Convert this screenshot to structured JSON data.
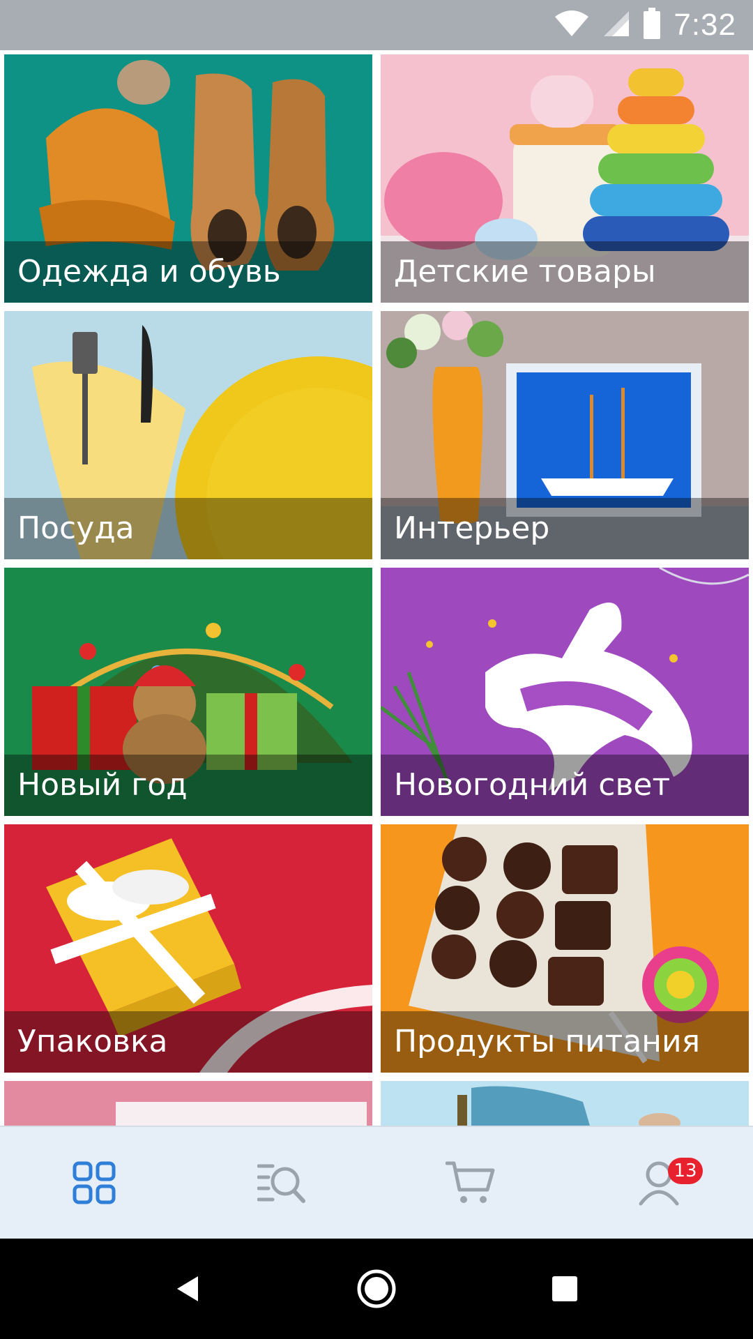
{
  "status_bar": {
    "time": "7:32",
    "icons": [
      "wifi-icon",
      "cell-signal-icon",
      "battery-icon"
    ]
  },
  "categories": [
    {
      "label": "Одежда и обувь",
      "image": "clothes-and-shoes-image"
    },
    {
      "label": "Детские товары",
      "image": "kids-goods-image"
    },
    {
      "label": "Посуда",
      "image": "tableware-image"
    },
    {
      "label": "Интерьер",
      "image": "interior-image"
    },
    {
      "label": "Новый год",
      "image": "new-year-image"
    },
    {
      "label": "Новогодний свет",
      "image": "new-year-lights-image"
    },
    {
      "label": "Упаковка",
      "image": "packaging-image"
    },
    {
      "label": "Продукты питания",
      "image": "food-products-image"
    }
  ],
  "bottom_nav": {
    "items": [
      {
        "icon": "catalog-grid-icon",
        "active": true
      },
      {
        "icon": "search-list-icon",
        "active": false
      },
      {
        "icon": "cart-icon",
        "active": false
      },
      {
        "icon": "profile-icon",
        "active": false,
        "badge": "13"
      }
    ],
    "active_color": "#2f7fd8",
    "inactive_color": "#9aa3ab",
    "badge_color": "#e8212e"
  },
  "system_nav": {
    "buttons": [
      "back-icon",
      "home-icon",
      "recents-icon"
    ]
  }
}
